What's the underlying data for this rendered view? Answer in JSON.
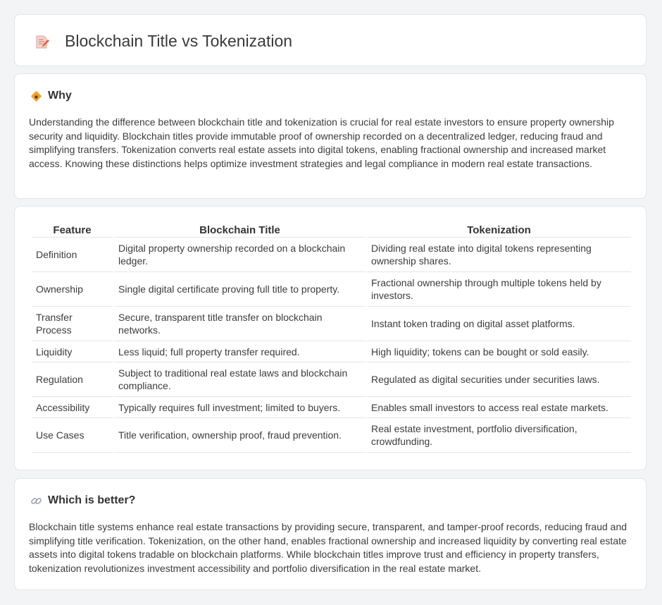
{
  "header": {
    "title": "Blockchain Title vs Tokenization",
    "icon": "memo-pencil-icon"
  },
  "why": {
    "heading": "Why",
    "icon": "diamond-sign-icon",
    "text": "Understanding the difference between blockchain title and tokenization is crucial for real estate investors to ensure property ownership security and liquidity. Blockchain titles provide immutable proof of ownership recorded on a decentralized ledger, reducing fraud and simplifying transfers. Tokenization converts real estate assets into digital tokens, enabling fractional ownership and increased market access. Knowing these distinctions helps optimize investment strategies and legal compliance in modern real estate transactions."
  },
  "table": {
    "headers": [
      "Feature",
      "Blockchain Title",
      "Tokenization"
    ],
    "rows": [
      {
        "feature": "Definition",
        "blockchain": "Digital property ownership recorded on a blockchain ledger.",
        "token": "Dividing real estate into digital tokens representing ownership shares."
      },
      {
        "feature": "Ownership",
        "blockchain": "Single digital certificate proving full title to property.",
        "token": "Fractional ownership through multiple tokens held by investors."
      },
      {
        "feature": "Transfer Process",
        "blockchain": "Secure, transparent title transfer on blockchain networks.",
        "token": "Instant token trading on digital asset platforms."
      },
      {
        "feature": "Liquidity",
        "blockchain": "Less liquid; full property transfer required.",
        "token": "High liquidity; tokens can be bought or sold easily."
      },
      {
        "feature": "Regulation",
        "blockchain": "Subject to traditional real estate laws and blockchain compliance.",
        "token": "Regulated as digital securities under securities laws."
      },
      {
        "feature": "Accessibility",
        "blockchain": "Typically requires full investment; limited to buyers.",
        "token": "Enables small investors to access real estate markets."
      },
      {
        "feature": "Use Cases",
        "blockchain": "Title verification, ownership proof, fraud prevention.",
        "token": "Real estate investment, portfolio diversification, crowdfunding."
      }
    ]
  },
  "better": {
    "heading": "Which is better?",
    "icon": "link-icon",
    "text": "Blockchain title systems enhance real estate transactions by providing secure, transparent, and tamper-proof records, reducing fraud and simplifying title verification. Tokenization, on the other hand, enables fractional ownership and increased liquidity by converting real estate assets into digital tokens tradable on blockchain platforms. While blockchain titles improve trust and efficiency in property transfers, tokenization revolutionizes investment accessibility and portfolio diversification in the real estate market."
  }
}
